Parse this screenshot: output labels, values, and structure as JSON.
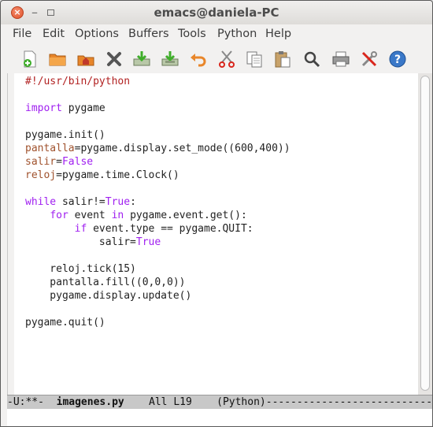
{
  "window": {
    "title": "emacs@daniela-PC",
    "close_glyph": "×",
    "min_glyph": "–"
  },
  "menu": [
    "File",
    "Edit",
    "Options",
    "Buffers",
    "Tools",
    "Python",
    "Help"
  ],
  "toolbar": [
    "new-file-icon",
    "open-folder-icon",
    "dired-icon",
    "kill-buffer-icon",
    "save-icon",
    "save-as-icon",
    "undo-icon",
    "cut-icon",
    "copy-icon",
    "paste-icon",
    "search-icon",
    "print-icon",
    "preferences-icon",
    "help-icon"
  ],
  "code_lines": [
    [
      {
        "t": "#!/usr/bin/python",
        "c": "com"
      }
    ],
    [
      {
        "t": "",
        "c": ""
      }
    ],
    [
      {
        "t": "import",
        "c": "kw"
      },
      {
        "t": " pygame",
        "c": ""
      }
    ],
    [
      {
        "t": "",
        "c": ""
      }
    ],
    [
      {
        "t": "pygame.init()",
        "c": ""
      }
    ],
    [
      {
        "t": "pantalla",
        "c": "var"
      },
      {
        "t": "=pygame.display.set_mode((600,400))",
        "c": ""
      }
    ],
    [
      {
        "t": "salir",
        "c": "var"
      },
      {
        "t": "=",
        "c": ""
      },
      {
        "t": "False",
        "c": "kw"
      }
    ],
    [
      {
        "t": "reloj",
        "c": "var"
      },
      {
        "t": "=pygame.time.Clock()",
        "c": ""
      }
    ],
    [
      {
        "t": "",
        "c": ""
      }
    ],
    [
      {
        "t": "while",
        "c": "kw"
      },
      {
        "t": " salir!=",
        "c": ""
      },
      {
        "t": "True",
        "c": "kw"
      },
      {
        "t": ":",
        "c": ""
      }
    ],
    [
      {
        "t": "    ",
        "c": ""
      },
      {
        "t": "for",
        "c": "kw"
      },
      {
        "t": " event ",
        "c": ""
      },
      {
        "t": "in",
        "c": "kw"
      },
      {
        "t": " pygame.event.get():",
        "c": ""
      }
    ],
    [
      {
        "t": "        ",
        "c": ""
      },
      {
        "t": "if",
        "c": "kw"
      },
      {
        "t": " event.type == pygame.QUIT:",
        "c": ""
      }
    ],
    [
      {
        "t": "            salir=",
        "c": ""
      },
      {
        "t": "True",
        "c": "kw"
      }
    ],
    [
      {
        "t": "",
        "c": ""
      }
    ],
    [
      {
        "t": "    reloj.tick(15)",
        "c": ""
      }
    ],
    [
      {
        "t": "    pantalla.fill((0,0,0))",
        "c": ""
      }
    ],
    [
      {
        "t": "    pygame.display.update()",
        "c": ""
      }
    ],
    [
      {
        "t": "",
        "c": ""
      }
    ],
    [
      {
        "t": "pygame.quit()",
        "c": ""
      }
    ]
  ],
  "modeline": {
    "prefix": "-U:**-  ",
    "buffer": "imagenes.py",
    "position": "    All L19    ",
    "mode": "(Python)",
    "dashes": "------------------------------"
  },
  "colors": {
    "keyword": "#a020f0",
    "variable": "#a0522d",
    "comment": "#b22222"
  }
}
